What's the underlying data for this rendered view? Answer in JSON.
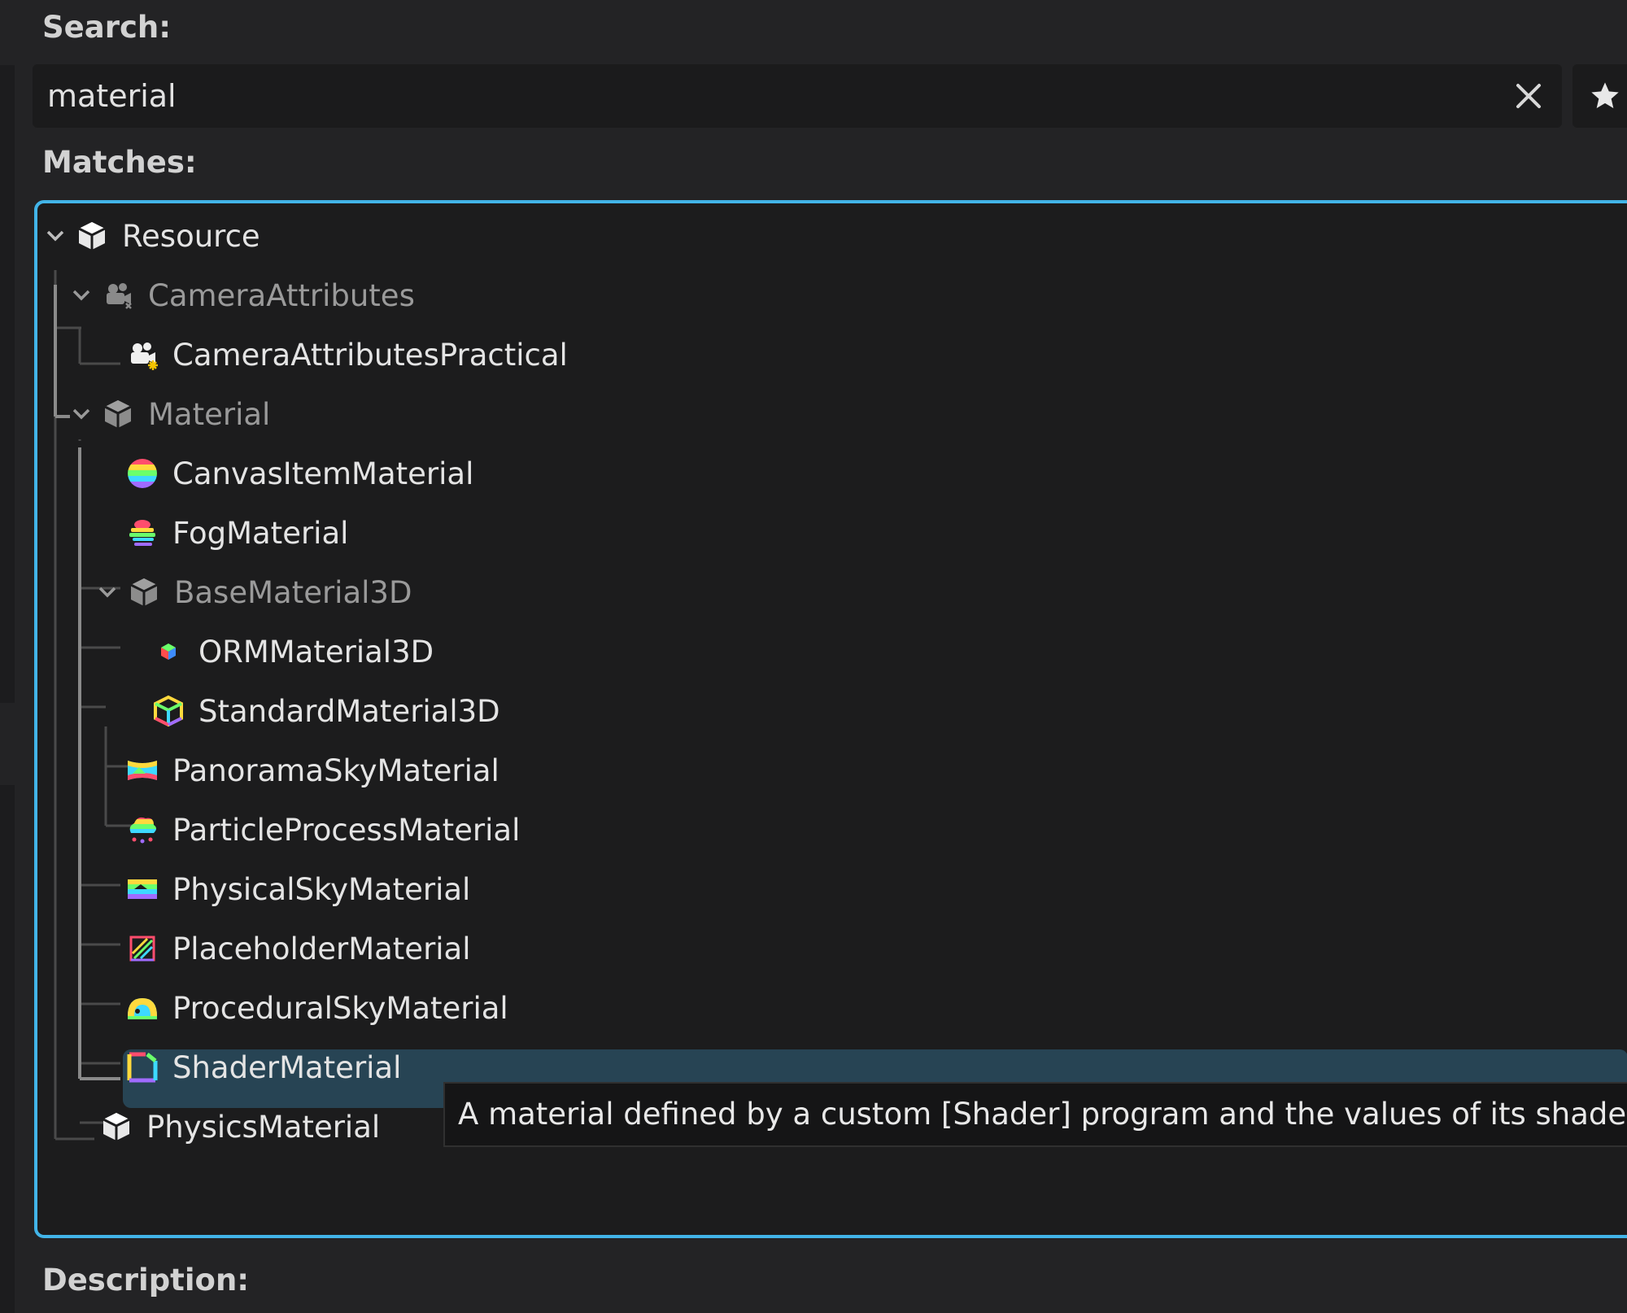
{
  "labels": {
    "search": "Search:",
    "matches": "Matches:",
    "description": "Description:"
  },
  "search": {
    "value": "material"
  },
  "icons": {
    "clear": "close-icon",
    "favorite": "star-icon",
    "expand": "chevron-down-icon"
  },
  "colors": {
    "accent": "#42b4e8",
    "selection": "#274454",
    "panel": "#1c1c1d",
    "background": "#232325"
  },
  "tree": [
    {
      "label": "Resource",
      "icon": "cube-white"
    },
    {
      "label": "CameraAttributes",
      "icon": "camera-gray"
    },
    {
      "label": "CameraAttributesPractical",
      "icon": "camera-white"
    },
    {
      "label": "Material",
      "icon": "cube-gray"
    },
    {
      "label": "CanvasItemMaterial",
      "icon": "rainbow-circle"
    },
    {
      "label": "FogMaterial",
      "icon": "rainbow-fog"
    },
    {
      "label": "BaseMaterial3D",
      "icon": "cube-gray"
    },
    {
      "label": "ORMMaterial3D",
      "icon": "rgb-cube"
    },
    {
      "label": "StandardMaterial3D",
      "icon": "rainbow-cube"
    },
    {
      "label": "PanoramaSkyMaterial",
      "icon": "rainbow-panorama"
    },
    {
      "label": "ParticleProcessMaterial",
      "icon": "rainbow-cloud"
    },
    {
      "label": "PhysicalSkyMaterial",
      "icon": "rainbow-sky"
    },
    {
      "label": "PlaceholderMaterial",
      "icon": "rainbow-hatched"
    },
    {
      "label": "ProceduralSkyMaterial",
      "icon": "rainbow-dome"
    },
    {
      "label": "ShaderMaterial",
      "icon": "rainbow-frame"
    },
    {
      "label": "PhysicsMaterial",
      "icon": "cube-white"
    }
  ],
  "tooltip": {
    "text": "A material defined by a custom [Shader] program and the values of its shader para"
  }
}
